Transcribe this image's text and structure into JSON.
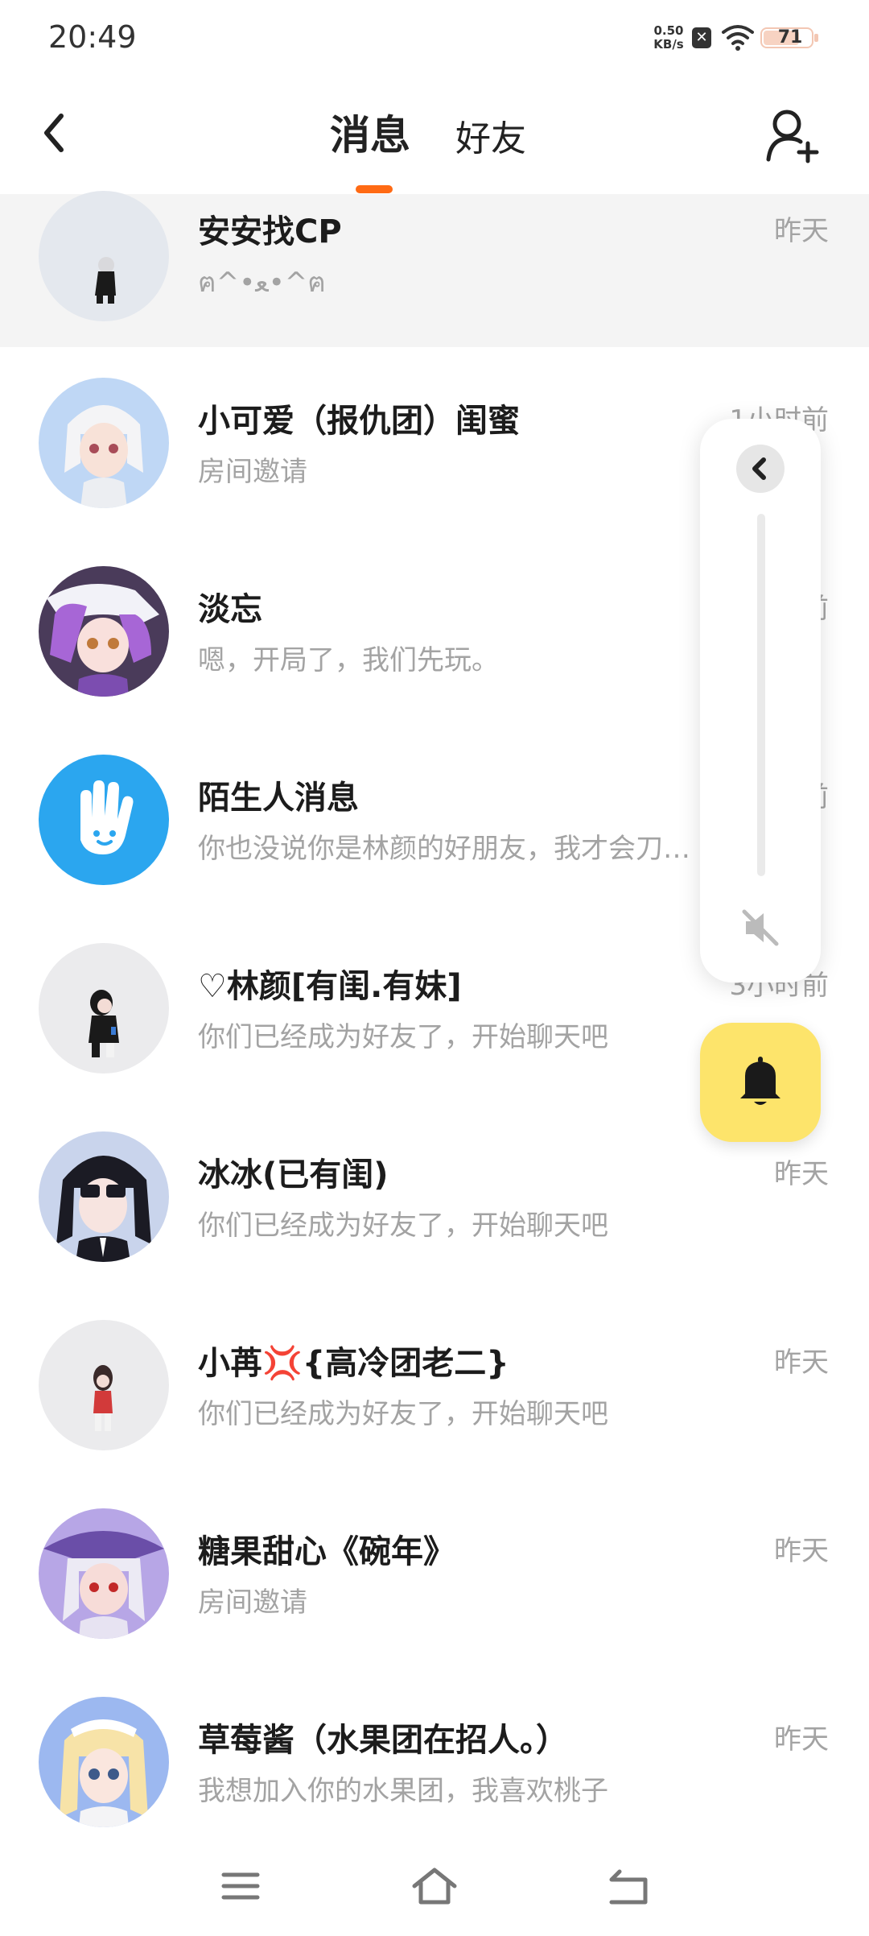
{
  "status_bar": {
    "time": "20:49",
    "net_speed_value": "0.50",
    "net_speed_unit": "KB/s",
    "battery_level": "71",
    "icons": [
      "notification-x-icon",
      "wifi-icon",
      "battery-icon"
    ]
  },
  "header": {
    "tabs": [
      {
        "label": "消息",
        "active": true
      },
      {
        "label": "好友",
        "active": false
      }
    ],
    "back_icon": "chevron-left-icon",
    "add_friend_icon": "add-user-icon",
    "accent_color": "#ff6a14"
  },
  "conversations": [
    {
      "name": "安安找CP",
      "preview": "ฅ^•ﻌ•^ฅ",
      "time": "昨天",
      "highlighted": true
    },
    {
      "name": "小可爱（报仇团）闺蜜",
      "preview": "房间邀请",
      "time": "1小时前"
    },
    {
      "name": "淡忘",
      "preview": "嗯，开局了，我们先玩。",
      "time": "前"
    },
    {
      "name": "陌生人消息",
      "preview": "你也没说你是林颜的好朋友，我才会刀…",
      "time": "前"
    },
    {
      "name": "♡林颜[有闺.有妹]",
      "preview": "你们已经成为好友了，开始聊天吧",
      "time": "3小时前"
    },
    {
      "name": "冰冰(已有闺)",
      "preview": "你们已经成为好友了，开始聊天吧",
      "time": "昨天"
    },
    {
      "name": "小苒💢{高冷团老二}",
      "preview": "你们已经成为好友了，开始聊天吧",
      "time": "昨天"
    },
    {
      "name": "糖果甜心《碗年》",
      "preview": "房间邀请",
      "time": "昨天"
    },
    {
      "name": "草莓酱（水果团在招人。）",
      "preview": "我想加入你的水果团，我喜欢桃子",
      "time": "昨天"
    }
  ],
  "volume_panel": {
    "collapse_icon": "chevron-left-icon",
    "mute_icon": "volume-mute-icon",
    "level": 0
  },
  "float_button": {
    "icon": "bell-icon",
    "color": "#fde46b"
  },
  "nav_bar": {
    "icons": [
      "menu-icon",
      "home-icon",
      "back-icon"
    ]
  }
}
